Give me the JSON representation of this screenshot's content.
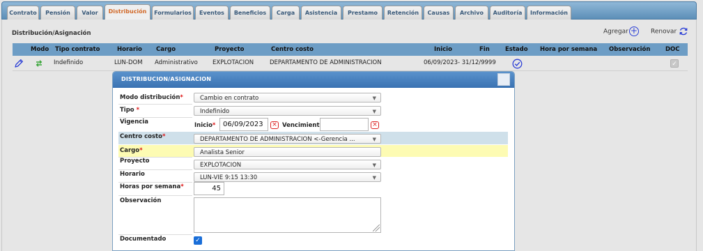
{
  "tabs": [
    {
      "label": "Contrato",
      "active": false
    },
    {
      "label": "Pensión",
      "active": false
    },
    {
      "label": "Valor",
      "active": false
    },
    {
      "label": "Distribución",
      "active": true
    },
    {
      "label": "Formularios",
      "active": false
    },
    {
      "label": "Eventos",
      "active": false
    },
    {
      "label": "Beneficios",
      "active": false
    },
    {
      "label": "Carga",
      "active": false
    },
    {
      "label": "Asistencia",
      "active": false
    },
    {
      "label": "Prestamo",
      "active": false
    },
    {
      "label": "Retención",
      "active": false
    },
    {
      "label": "Causas",
      "active": false
    },
    {
      "label": "Archivo",
      "active": false
    },
    {
      "label": "Auditoría",
      "active": false
    },
    {
      "label": "Información",
      "active": false
    }
  ],
  "section": {
    "title": "Distribución/Asignación",
    "add_label": "Agregar",
    "renew_label": "Renovar"
  },
  "table": {
    "headers": {
      "modo": "Modo",
      "tipo_contrato": "Tipo contrato",
      "horario": "Horario",
      "cargo": "Cargo",
      "proyecto": "Proyecto",
      "centro_costo": "Centro costo",
      "inicio": "Inicio",
      "fin": "Fin",
      "estado": "Estado",
      "hora_semana": "Hora por semana",
      "observacion": "Observación",
      "doc": "DOC"
    },
    "row": {
      "tipo_contrato": "Indefinido",
      "horario": "LUN-DOM",
      "cargo": "Administrativo",
      "proyecto": "EXPLOTACION",
      "centro_costo": "DEPARTAMENTO DE ADMINISTRACION",
      "inicio_fin": "06/09/2023- 31/12/9999",
      "doc_checked": true
    }
  },
  "dialog": {
    "title": "DISTRIBUCION/ASIGNACION",
    "modo_label": "Modo distribución",
    "modo_value": "Cambio en contrato",
    "tipo_label": "Tipo",
    "tipo_value": "Indefinido",
    "vigencia_label": "Vigencia",
    "inicio_label": "Inicio",
    "inicio_value": "06/09/2023",
    "vencimiento_label": "Vencimiento",
    "vencimiento_value": "",
    "centro_label": "Centro costo",
    "centro_value": "DEPARTAMENTO DE ADMINISTRACION <-Gerencia ...",
    "cargo_label": "Cargo",
    "cargo_value": "Analista Senior",
    "proyecto_label": "Proyecto",
    "proyecto_value": "EXPLOTACION",
    "horario_label": "Horario",
    "horario_value": "LUN-VIE 9:15 13:30",
    "horas_label": "Horas por semana",
    "horas_value": "45",
    "observacion_label": "Observación",
    "observacion_value": "",
    "documentado_label": "Documentado",
    "documentado_checked": true,
    "required_mark": "*"
  },
  "colors": {
    "header_blue": "#6d9dc5",
    "active_tab_text": "#d26a2a",
    "highlight_blue_row": "#cfe0ea",
    "highlight_yellow_row": "#fdfbb3",
    "required_red": "#dd1111"
  }
}
